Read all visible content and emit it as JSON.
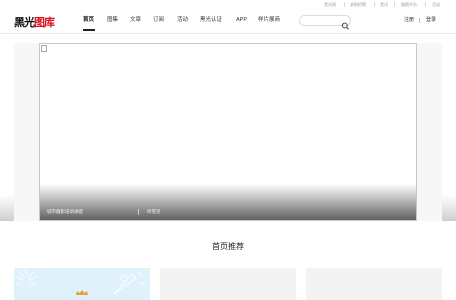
{
  "top_links": [
    "黑光网",
    "求职招聘",
    "黑讯",
    "摄图平台",
    "活动"
  ],
  "logo": {
    "part1": "黑光",
    "part2": "图库"
  },
  "nav": [
    "首页",
    "图集",
    "文章",
    "订阅",
    "活动",
    "黑光认证",
    "APP",
    "样片展商"
  ],
  "search": {
    "placeholder": "",
    "icon": "search-icon"
  },
  "auth": {
    "register": "注册",
    "login": "登录"
  },
  "banner": {
    "caption_title": "城市摄影培训讲座",
    "caption_author": "听雪见"
  },
  "section": {
    "title": "首页推荐"
  },
  "colors": {
    "brand_red": "#d8111b",
    "card_blue": "#dff1fb",
    "crown": "#e8a23c"
  }
}
